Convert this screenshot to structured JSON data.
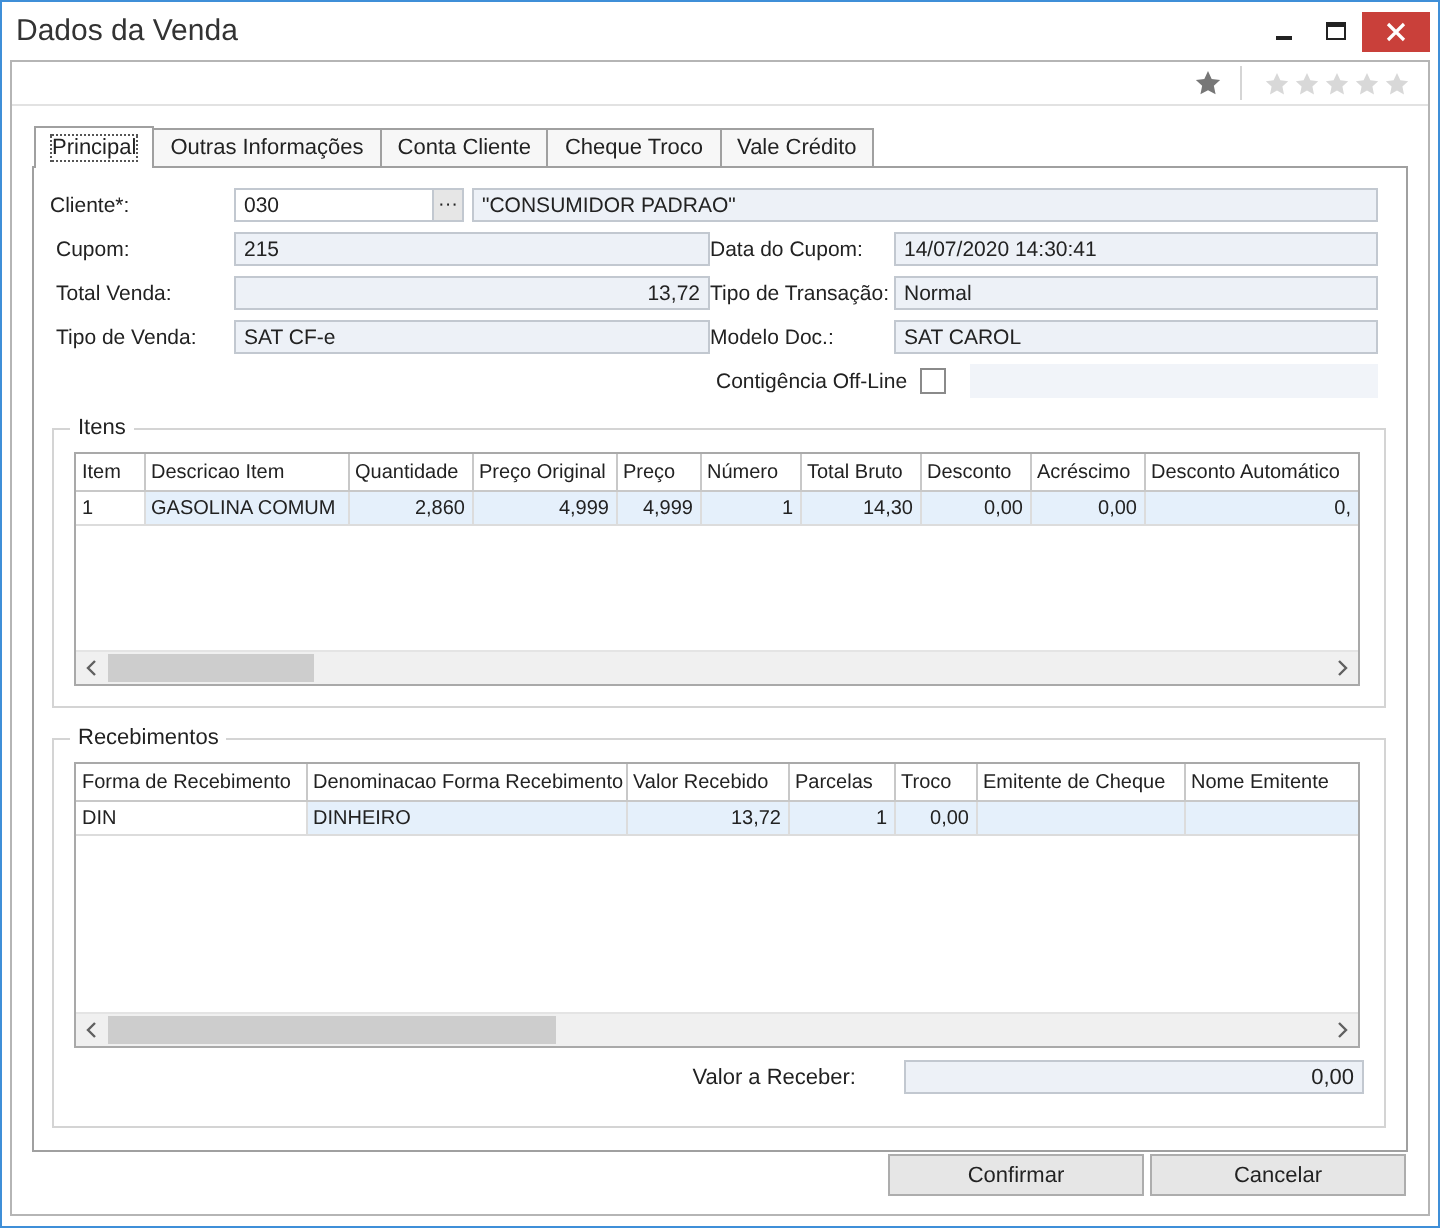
{
  "window": {
    "title": "Dados da Venda"
  },
  "rating": {
    "stars": 0
  },
  "tabs": [
    {
      "label": "Principal",
      "selected": true
    },
    {
      "label": "Outras Informações",
      "selected": false
    },
    {
      "label": "Conta Cliente",
      "selected": false
    },
    {
      "label": "Cheque Troco",
      "selected": false
    },
    {
      "label": "Vale Crédito",
      "selected": false
    }
  ],
  "cliente": {
    "label": "Cliente*:",
    "code": "030",
    "button": "···",
    "name": "\"CONSUMIDOR PADRAO\""
  },
  "left_fields": [
    {
      "label": "Cupom:",
      "value": "215",
      "kind": "text"
    },
    {
      "label": "Total Venda:",
      "value": "13,72",
      "kind": "number"
    },
    {
      "label": "Tipo de Venda:",
      "value": "SAT CF-e",
      "kind": "text"
    }
  ],
  "right_fields": [
    {
      "label": "Data do Cupom:",
      "value": "14/07/2020 14:30:41",
      "kind": "text"
    },
    {
      "label": "Tipo de Transação:",
      "value": "Normal",
      "kind": "text"
    },
    {
      "label": "Modelo Doc.:",
      "value": "SAT CAROL",
      "kind": "text"
    }
  ],
  "contingencia": {
    "label": "Contigência Off-Line",
    "checked": false
  },
  "itens": {
    "legend": "Itens",
    "columns": [
      {
        "label": "Item",
        "kind": "text"
      },
      {
        "label": "Descricao Item",
        "kind": "text"
      },
      {
        "label": "Quantidade",
        "kind": "number"
      },
      {
        "label": "Preço Original",
        "kind": "number"
      },
      {
        "label": "Preço",
        "kind": "number"
      },
      {
        "label": "Número",
        "kind": "number"
      },
      {
        "label": "Total Bruto",
        "kind": "number"
      },
      {
        "label": "Desconto",
        "kind": "number"
      },
      {
        "label": "Acréscimo",
        "kind": "number"
      },
      {
        "label": "Desconto Automático",
        "kind": "number"
      }
    ],
    "rows": [
      {
        "selected": true,
        "cells": [
          "1",
          "GASOLINA COMUM",
          "2,860",
          "4,999",
          "4,999",
          "1",
          "14,30",
          "0,00",
          "0,00",
          "0,"
        ]
      }
    ]
  },
  "recebimentos": {
    "legend": "Recebimentos",
    "columns": [
      {
        "label": "Forma de Recebimento",
        "kind": "text"
      },
      {
        "label": "Denominacao Forma Recebimento",
        "kind": "text"
      },
      {
        "label": "Valor Recebido",
        "kind": "number"
      },
      {
        "label": "Parcelas",
        "kind": "number"
      },
      {
        "label": "Troco",
        "kind": "number"
      },
      {
        "label": "Emitente de Cheque",
        "kind": "text"
      },
      {
        "label": "Nome Emitente",
        "kind": "text"
      }
    ],
    "rows": [
      {
        "selected": true,
        "cells": [
          "DIN",
          "DINHEIRO",
          "13,72",
          "1",
          "0,00",
          "",
          ""
        ]
      }
    ],
    "total": {
      "label": "Valor a Receber:",
      "value": "0,00"
    }
  },
  "buttons": [
    {
      "label": "Confirmar"
    },
    {
      "label": "Cancelar"
    }
  ]
}
